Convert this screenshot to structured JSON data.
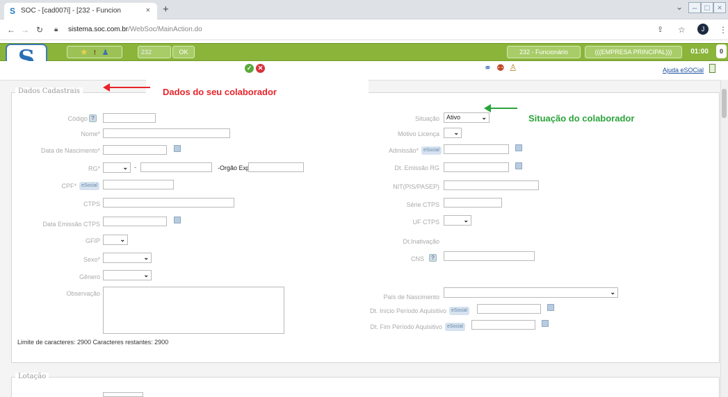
{
  "browser": {
    "tab_title": "SOC - [cad007i] - [232 - Funcion",
    "tab_close": "×",
    "new_tab": "+",
    "url_domain": "sistema.soc.com.br",
    "url_path": "/WebSoc/MainAction.do",
    "win_min": "‒",
    "win_max": "□",
    "win_close": "×"
  },
  "header": {
    "logo_text": "S",
    "quick_field_value": "232",
    "ok_label": "OK",
    "funcionario_label": "232 - Funcionário",
    "empresa_label": "(((EMPRESA PRINCIPAL)))",
    "clock": "01:00",
    "notification_count": "0",
    "ajuda_link": "Ajuda eSOCial"
  },
  "annotations": {
    "dados": "Dados do seu colaborador",
    "situacao": "Situação do colaborador",
    "dados_color": "#e8232a",
    "situacao_color": "#2aa33a"
  },
  "section1": {
    "legend": "Dados Cadastrais",
    "left": {
      "codigo": "Código",
      "nome": "Nome*",
      "nascimento": "Data de Nascimento*",
      "rg": "RG*",
      "rg_sep": "-",
      "orgao": "-Orgão Exp.",
      "cpf": "CPF*",
      "ctps": "CTPS",
      "emissao_ctps": "Data Emissão CTPS",
      "gfip": "GFIP",
      "sexo": "Sexo*",
      "genero": "Gênero",
      "observacao": "Observação",
      "limite": "Limite de caracteres: 2900  Caracteres restantes: 2900"
    },
    "right": {
      "situacao": "Situação",
      "situacao_value": "Ativo",
      "motivo": "Motivo Licença",
      "admissao": "Admissão*",
      "emissao_rg": "Dt. Emissão RG",
      "nit": "NIT(PIS/PASEP)",
      "serie_ctps": "Série CTPS",
      "uf_ctps": "UF CTPS",
      "inativacao": "Dt.Inativação",
      "cns": "CNS",
      "pais": "País de Nascimento",
      "inicio_aquisitivo": "Dt. Início Período Aquisitivo",
      "fim_aquisitivo": "Dt. Fim Período Aquisitivo"
    },
    "esocial_badge": "eSocial",
    "help_badge": "?"
  },
  "section2": {
    "legend": "Lotação"
  }
}
